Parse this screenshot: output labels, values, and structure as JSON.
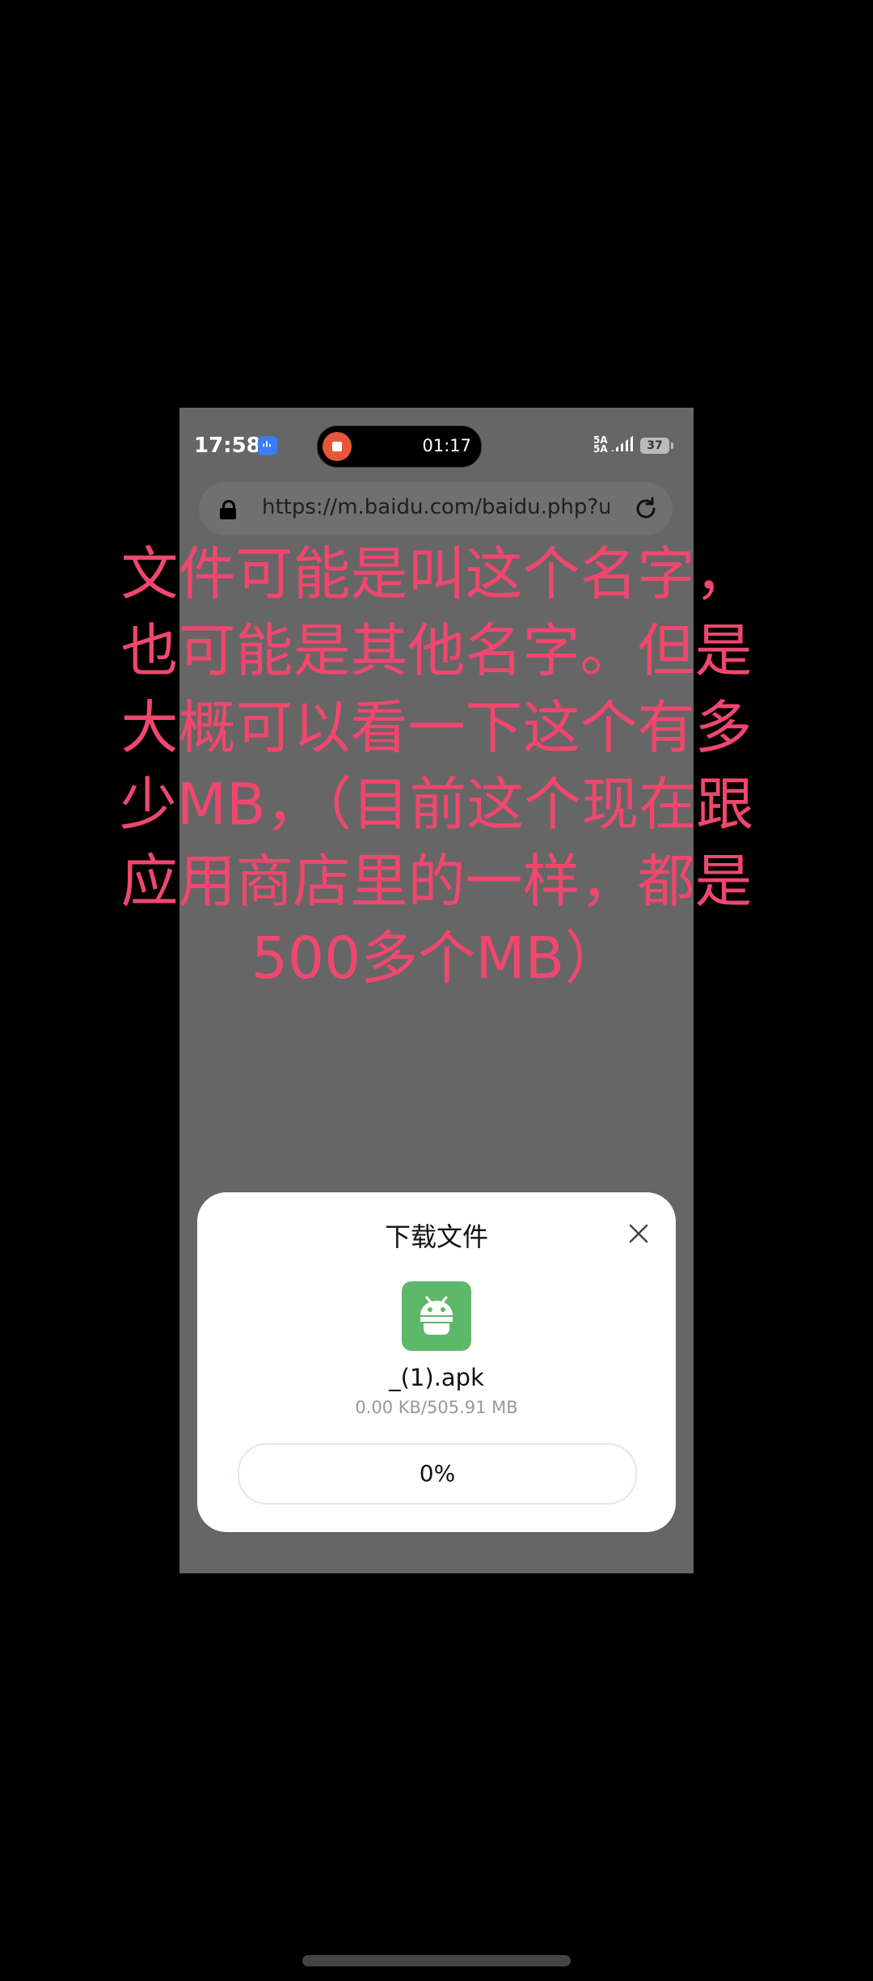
{
  "status_bar": {
    "time": "17:58",
    "recording_time": "01:17",
    "signal_label_top": "5A",
    "signal_label_bottom": "5A",
    "battery": "37"
  },
  "browser": {
    "url": "https://m.baidu.com/baidu.php?url"
  },
  "annotation": {
    "text": "文件可能是叫这个名字，也可能是其他名字。但是大概可以看一下这个有多少MB，（目前这个现在跟应用商店里的一样，都是500多个MB）",
    "color": "#f0476e"
  },
  "download_dialog": {
    "title": "下载文件",
    "file_name": "_(1).apk",
    "file_size": "0.00 KB/505.91 MB",
    "progress_label": "0%",
    "progress_fraction": 0,
    "icon_color": "#5eb86a"
  }
}
